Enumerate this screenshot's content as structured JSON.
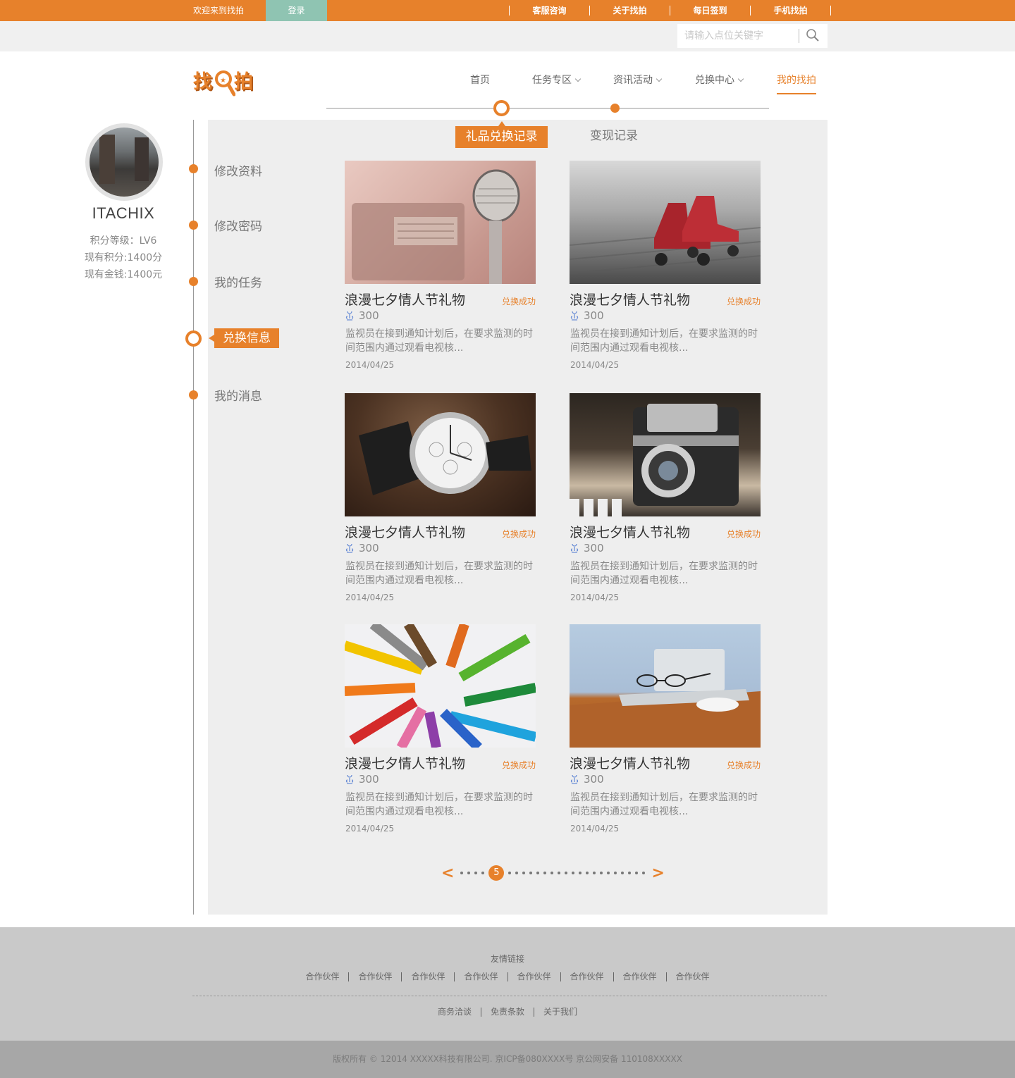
{
  "topbar": {
    "welcome": "欢迎来到找拍",
    "login": "登录",
    "links": [
      "客服咨询",
      "关于找拍",
      "每日签到",
      "手机找拍"
    ]
  },
  "search": {
    "placeholder": "请输入点位关键字",
    "icon": "search-icon"
  },
  "logo": {
    "left": "找",
    "right": "拍",
    "icon": "magnifier-icon"
  },
  "nav": {
    "items": [
      {
        "label": "首页"
      },
      {
        "label": "任务专区"
      },
      {
        "label": "资讯活动"
      },
      {
        "label": "兑换中心"
      },
      {
        "label": "我的找拍"
      }
    ]
  },
  "profile": {
    "name": "ITACHIX",
    "level": "积分等级：LV6",
    "points": "现有积分:1400分",
    "money": "现有金钱:1400元"
  },
  "sidebar": {
    "items": [
      "修改资料",
      "修改密码",
      "我的任务",
      "兑换信息",
      "我的消息"
    ]
  },
  "tabs": {
    "active": "礼品兑换记录",
    "other": "变现记录"
  },
  "cards": [
    {
      "title": "浪漫七夕情人节礼物",
      "status": "兑换成功",
      "points": "300",
      "desc": "监视员在接到通知计划后，在要求监测的时间范围内通过观看电视核...",
      "date": "2014/04/25",
      "image": "vintage-radio-microphone"
    },
    {
      "title": "浪漫七夕情人节礼物",
      "status": "兑换成功",
      "points": "300",
      "desc": "监视员在接到通知计划后，在要求监测的时间范围内通过观看电视核...",
      "date": "2014/04/25",
      "image": "red-roller-skates"
    },
    {
      "title": "浪漫七夕情人节礼物",
      "status": "兑换成功",
      "points": "300",
      "desc": "监视员在接到通知计划后，在要求监测的时间范围内通过观看电视核...",
      "date": "2014/04/25",
      "image": "wrist-watch"
    },
    {
      "title": "浪漫七夕情人节礼物",
      "status": "兑换成功",
      "points": "300",
      "desc": "监视员在接到通知计划后，在要求监测的时间范围内通过观看电视核...",
      "date": "2014/04/25",
      "image": "retro-camera"
    },
    {
      "title": "浪漫七夕情人节礼物",
      "status": "兑换成功",
      "points": "300",
      "desc": "监视员在接到通知计划后，在要求监测的时间范围内通过观看电视核...",
      "date": "2014/04/25",
      "image": "colored-pencils"
    },
    {
      "title": "浪漫七夕情人节礼物",
      "status": "兑换成功",
      "points": "300",
      "desc": "监视员在接到通知计划后，在要求监测的时间范围内通过观看电视核...",
      "date": "2014/04/25",
      "image": "laptop-glasses-mouse"
    }
  ],
  "pager": {
    "prev": "<",
    "current": "5",
    "next": ">"
  },
  "footer": {
    "links_title": "友情链接",
    "partners": [
      "合作伙伴",
      "合作伙伴",
      "合作伙伴",
      "合作伙伴",
      "合作伙伴",
      "合作伙伴",
      "合作伙伴",
      "合作伙伴"
    ],
    "bottom_links": [
      "商务洽谈",
      "免责条款",
      "关于我们"
    ],
    "copyright": "版权所有 © 12014 XXXXX科技有限公司. 京ICP备080XXXX号 京公网安备 110108XXXXX"
  },
  "colors": {
    "accent": "#e7812b",
    "login_bg": "#8fc4b2",
    "panel_bg": "#eeeeee",
    "footer_bg": "#c9c9c9",
    "copyright_bg": "#a7a7a7"
  }
}
